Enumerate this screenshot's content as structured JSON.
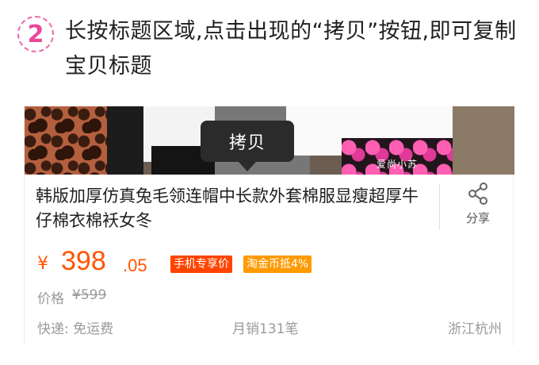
{
  "step": {
    "number": "2",
    "instruction": "长按标题区域,点击出现的“拷贝”按钮,即可复制宝贝标题"
  },
  "product": {
    "photo_watermark": "爱尚小苏",
    "tooltip_label": "拷贝",
    "title": "韩版加厚仿真兔毛领连帽中长款外套棉服显瘦超厚牛仔棉衣棉袄女冬",
    "share_label": "分享",
    "price": {
      "currency": "¥",
      "integer": "398",
      "decimal": ".05"
    },
    "badges": [
      "手机专享价",
      "淘金币抵4%"
    ],
    "original_price": {
      "label": "价格",
      "value": "¥599"
    },
    "shipping": "快递: 免运费",
    "monthly_sales": "月销131笔",
    "location": "浙江杭州"
  },
  "colors": {
    "accent_pink": "#e8489a",
    "price_orange": "#ff5500",
    "badge_red": "#ff4400",
    "badge_orange": "#ff9a00",
    "tooltip_bg": "#2b2b2b"
  },
  "icons": [
    "share-icon"
  ]
}
